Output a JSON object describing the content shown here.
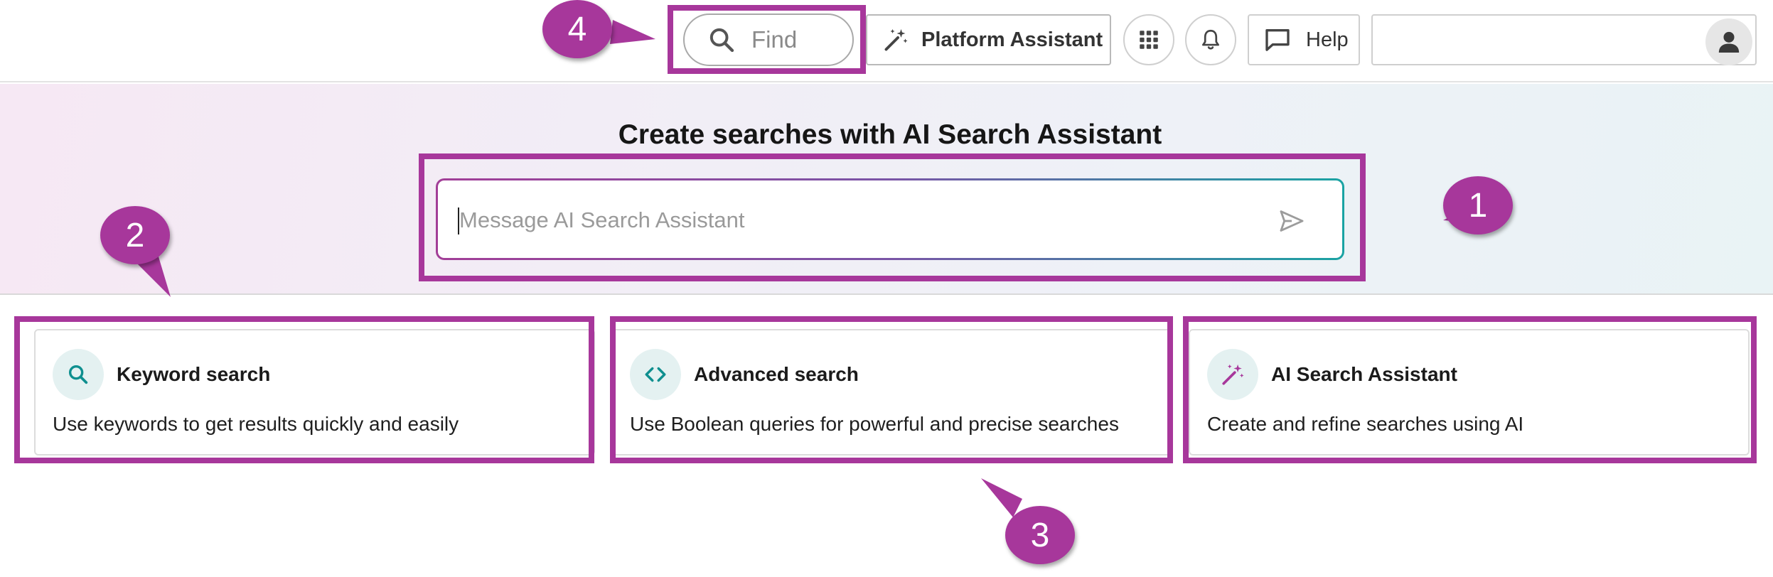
{
  "topbar": {
    "find_placeholder": "Find",
    "platform_assistant_label": "Platform Assistant",
    "apps_icon": "grid-icon",
    "notifications_icon": "bell-icon",
    "help_label": "Help",
    "avatar_icon": "user-icon"
  },
  "hero": {
    "title": "Create searches with AI Search Assistant",
    "input_placeholder": "Message AI Search Assistant",
    "send_icon": "send-icon"
  },
  "cards": [
    {
      "title": "Keyword search",
      "description": "Use keywords to get results quickly and easily",
      "icon": "search-icon"
    },
    {
      "title": "Advanced search",
      "description": "Use Boolean queries for powerful and precise searches",
      "icon": "code-icon"
    },
    {
      "title": "AI Search Assistant",
      "description": "Create and refine searches using AI",
      "icon": "magic-wand-icon"
    }
  ],
  "annotations": {
    "color": "#a7379b",
    "badges": [
      "1",
      "2",
      "3",
      "4"
    ]
  },
  "colors": {
    "accent_magenta": "#a7379b",
    "accent_teal": "#1aa3a3",
    "icon_bg": "#e4f1f1"
  }
}
